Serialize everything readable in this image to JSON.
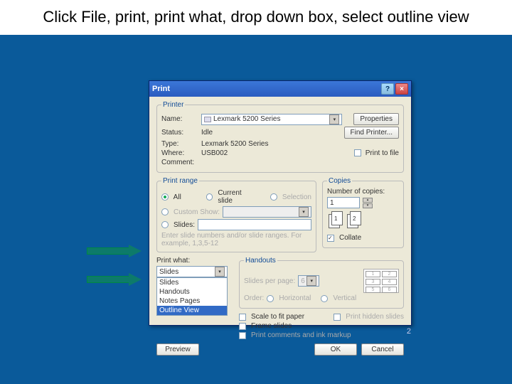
{
  "slide": {
    "title": "Click File, print, print what, drop down box, select outline view",
    "page_number": "2"
  },
  "dialog": {
    "title": "Print",
    "help": "?",
    "close": "×",
    "printer": {
      "legend": "Printer",
      "name_lbl": "Name:",
      "name_val": "Lexmark 5200 Series",
      "properties_btn": "Properties",
      "status_lbl": "Status:",
      "status_val": "Idle",
      "type_lbl": "Type:",
      "type_val": "Lexmark 5200 Series",
      "where_lbl": "Where:",
      "where_val": "USB002",
      "comment_lbl": "Comment:",
      "find_printer_btn": "Find Printer...",
      "print_to_file": "Print to file"
    },
    "range": {
      "legend": "Print range",
      "all": "All",
      "current": "Current slide",
      "selection": "Selection",
      "custom_show": "Custom Show:",
      "slides": "Slides:",
      "hint": "Enter slide numbers and/or slide ranges. For example, 1,3,5-12"
    },
    "copies": {
      "legend": "Copies",
      "number_lbl": "Number of copies:",
      "number_val": "1",
      "sheet1": "1",
      "sheet2": "2",
      "collate": "Collate"
    },
    "print_what": {
      "label": "Print what:",
      "selected": "Slides",
      "items": [
        "Slides",
        "Handouts",
        "Notes Pages",
        "Outline View"
      ]
    },
    "handouts": {
      "legend": "Handouts",
      "spp_lbl": "Slides per page:",
      "spp_val": "6",
      "order_lbl": "Order:",
      "horz": "Horizontal",
      "vert": "Vertical",
      "slots": [
        "1",
        "2",
        "3",
        "4",
        "5",
        "6"
      ]
    },
    "options": {
      "scale": "Scale to fit paper",
      "frame": "Frame slides",
      "comments": "Print comments and ink markup",
      "hidden": "Print hidden slides"
    },
    "buttons": {
      "preview": "Preview",
      "ok": "OK",
      "cancel": "Cancel"
    }
  }
}
